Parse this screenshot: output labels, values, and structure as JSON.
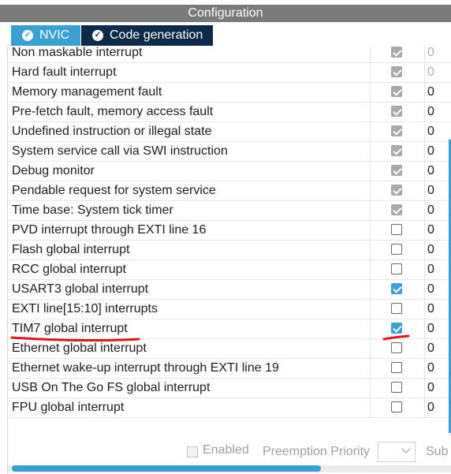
{
  "window": {
    "title": "Configuration"
  },
  "tabs": [
    {
      "label": "NVIC",
      "icon": "check-circle-icon",
      "active": false
    },
    {
      "label": "Code generation",
      "icon": "check-circle-icon",
      "active": true
    }
  ],
  "interrupts": [
    {
      "name": "Non maskable interrupt",
      "enabled": true,
      "locked": true,
      "priority": "0"
    },
    {
      "name": "Hard fault interrupt",
      "enabled": true,
      "locked": true,
      "priority": "0"
    },
    {
      "name": "Memory management fault",
      "enabled": true,
      "locked": true,
      "priority": "0"
    },
    {
      "name": "Pre-fetch fault, memory access fault",
      "enabled": true,
      "locked": true,
      "priority": "0"
    },
    {
      "name": "Undefined instruction or illegal state",
      "enabled": true,
      "locked": true,
      "priority": "0"
    },
    {
      "name": "System service call via SWI instruction",
      "enabled": true,
      "locked": true,
      "priority": "0"
    },
    {
      "name": "Debug monitor",
      "enabled": true,
      "locked": true,
      "priority": "0"
    },
    {
      "name": "Pendable request for system service",
      "enabled": true,
      "locked": true,
      "priority": "0"
    },
    {
      "name": "Time base: System tick timer",
      "enabled": true,
      "locked": true,
      "priority": "0"
    },
    {
      "name": "PVD interrupt through EXTI line 16",
      "enabled": false,
      "locked": false,
      "priority": "0"
    },
    {
      "name": "Flash global interrupt",
      "enabled": false,
      "locked": false,
      "priority": "0"
    },
    {
      "name": "RCC global interrupt",
      "enabled": false,
      "locked": false,
      "priority": "0"
    },
    {
      "name": "USART3 global interrupt",
      "enabled": true,
      "locked": false,
      "priority": "0"
    },
    {
      "name": "EXTI line[15:10] interrupts",
      "enabled": false,
      "locked": false,
      "priority": "0"
    },
    {
      "name": "TIM7 global interrupt",
      "enabled": true,
      "locked": false,
      "priority": "0"
    },
    {
      "name": "Ethernet global interrupt",
      "enabled": false,
      "locked": false,
      "priority": "0"
    },
    {
      "name": "Ethernet wake-up interrupt through EXTI line 19",
      "enabled": false,
      "locked": false,
      "priority": "0"
    },
    {
      "name": "USB On The Go FS global interrupt",
      "enabled": false,
      "locked": false,
      "priority": "0"
    },
    {
      "name": "FPU global interrupt",
      "enabled": false,
      "locked": false,
      "priority": "0"
    }
  ],
  "footer": {
    "enabled_label": "Enabled",
    "preemption_label": "Preemption Priority",
    "preemption_value": "",
    "sub_label": "Sub"
  },
  "colors": {
    "accent": "#3a9fd3",
    "tab_active_bg": "#0d2b49",
    "title_bg": "#7a7a7a",
    "annotation_red": "#e0141a"
  }
}
